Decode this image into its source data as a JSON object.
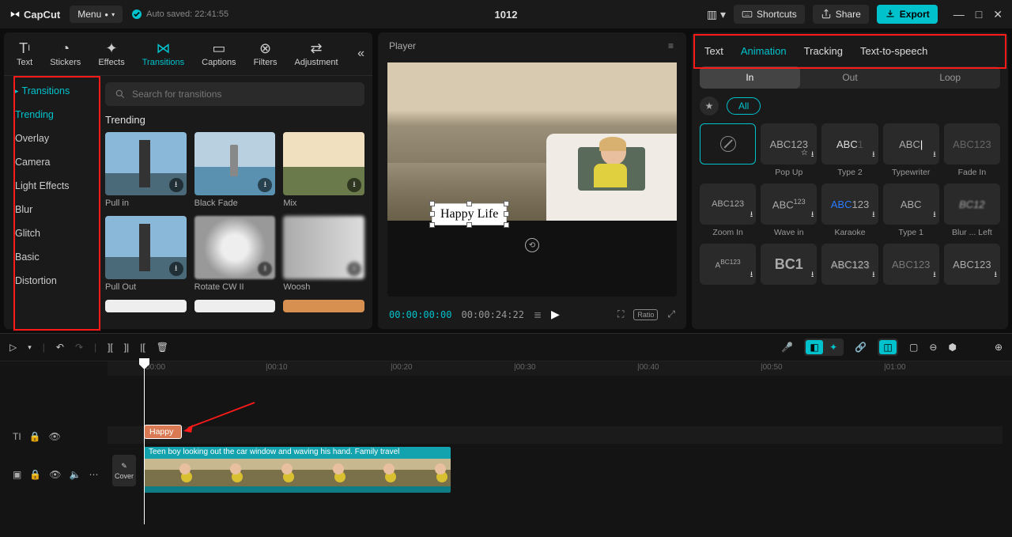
{
  "titlebar": {
    "app": "CapCut",
    "menu": "Menu",
    "autosave": "Auto saved: 22:41:55",
    "project": "1012",
    "shortcuts": "Shortcuts",
    "share": "Share",
    "export": "Export"
  },
  "tools": {
    "text": "Text",
    "stickers": "Stickers",
    "effects": "Effects",
    "transitions": "Transitions",
    "captions": "Captions",
    "filters": "Filters",
    "adjustment": "Adjustment"
  },
  "categories": {
    "header": "Transitions",
    "items": [
      "Trending",
      "Overlay",
      "Camera",
      "Light Effects",
      "Blur",
      "Glitch",
      "Basic",
      "Distortion"
    ]
  },
  "search_placeholder": "Search for transitions",
  "section": "Trending",
  "transitions": {
    "r1": [
      "Pull in",
      "Black Fade",
      "Mix"
    ],
    "r2": [
      "Pull Out",
      "Rotate CW II",
      "Woosh"
    ]
  },
  "player": {
    "title": "Player",
    "overlay_text": "Happy Life",
    "time_cur": "00:00:00:00",
    "time_dur": "00:00:24:22",
    "ratio": "Ratio"
  },
  "right": {
    "tabs": [
      "Text",
      "Animation",
      "Tracking",
      "Text-to-speech"
    ],
    "modes": [
      "In",
      "Out",
      "Loop"
    ],
    "filter": "All",
    "anims": {
      "r1": [
        "",
        "Pop Up",
        "Type 2",
        "Typewriter",
        "Fade In"
      ],
      "r2": [
        "Zoom In",
        "Wave in",
        "Karaoke",
        "Type 1",
        "Blur ... Left"
      ]
    },
    "sample": "ABC123",
    "sample_abc": "ABC",
    "sample_bc": "BC12"
  },
  "timeline": {
    "ticks": [
      "00:00",
      "|00:10",
      "|00:20",
      "|00:30",
      "|00:40",
      "|00:50",
      "|01:00"
    ],
    "cover": "Cover",
    "text_clip": "Happy",
    "video_label": "Teen boy looking out the car window and waving his hand. Family travel"
  }
}
